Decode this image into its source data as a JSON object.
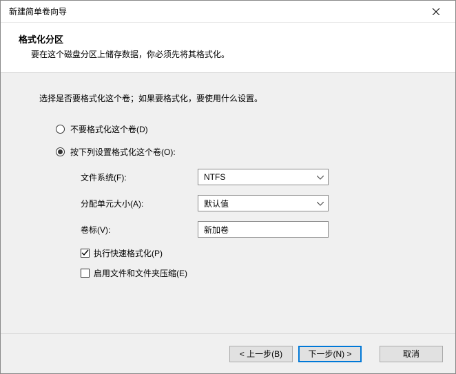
{
  "window": {
    "title": "新建简单卷向导"
  },
  "header": {
    "title": "格式化分区",
    "subtitle": "要在这个磁盘分区上储存数据，你必须先将其格式化。"
  },
  "content": {
    "instruction": "选择是否要格式化这个卷；如果要格式化，要使用什么设置。",
    "radio_no_format": "不要格式化这个卷(D)",
    "radio_format": "按下列设置格式化这个卷(O):",
    "filesystem_label": "文件系统(F):",
    "filesystem_value": "NTFS",
    "allocation_label": "分配单元大小(A):",
    "allocation_value": "默认值",
    "volume_label_label": "卷标(V):",
    "volume_label_value": "新加卷",
    "quick_format": "执行快速格式化(P)",
    "compression": "启用文件和文件夹压缩(E)"
  },
  "footer": {
    "back": "< 上一步(B)",
    "next": "下一步(N) >",
    "cancel": "取消"
  }
}
